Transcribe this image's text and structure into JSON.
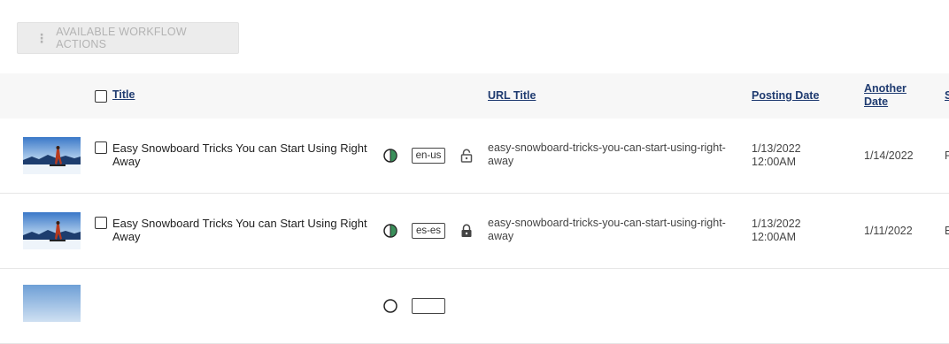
{
  "toolbar": {
    "workflow_actions_label": "AVAILABLE WORKFLOW ACTIONS",
    "workflow_actions_icon": "vertical-ellipsis-icon"
  },
  "table": {
    "headers": {
      "title": "Title",
      "url_title": "URL Title",
      "posting_date": "Posting Date",
      "another_date_line1": "Another",
      "another_date_line2": "Date",
      "status_clipped": "S"
    },
    "rows": [
      {
        "title_line1": "Easy Snowboard Tricks You can Start Using Right",
        "title_line2": "Away",
        "locale": "en-us",
        "lock": "unlocked",
        "url_line1": "easy-snowboard-tricks-you-can-start-using-right-",
        "url_line2": "away",
        "posting_date_line1": "1/13/2022",
        "posting_date_line2": "12:00AM",
        "another_date": "1/14/2022",
        "status_clipped": "P"
      },
      {
        "title_line1": "Easy Snowboard Tricks You can Start Using Right",
        "title_line2": "Away",
        "locale": "es-es",
        "lock": "locked",
        "url_line1": "easy-snowboard-tricks-you-can-start-using-right-",
        "url_line2": "away",
        "posting_date_line1": "1/13/2022",
        "posting_date_line2": "12:00AM",
        "another_date": "1/11/2022",
        "status_clipped": "E"
      }
    ]
  },
  "colors": {
    "header_link": "#1f3b70",
    "status_green": "#3a8f5a",
    "toolbar_bg": "#ececec"
  }
}
